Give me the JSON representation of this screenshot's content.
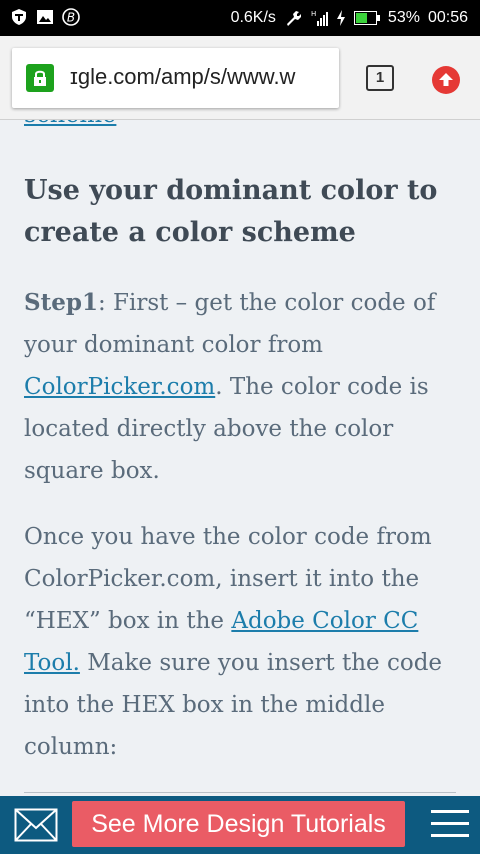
{
  "status_bar": {
    "speed": "0.6K/s",
    "battery": "53%",
    "time": "00:56",
    "icons": [
      "vpn-shield-icon",
      "gallery-icon",
      "bitcoin-icon",
      "wrench-icon",
      "signal-icon",
      "charging-icon",
      "battery-icon"
    ]
  },
  "browser": {
    "url": "ɪgle.com/amp/s/www.w",
    "tab_count": "1",
    "icons": [
      "lock-icon",
      "tabs-icon",
      "update-arrow-icon"
    ],
    "colors": {
      "lock": "#1da21d",
      "update": "#e53935"
    }
  },
  "article": {
    "prev_link": "scheme",
    "heading": "Use your dominant color to create a color scheme",
    "step_label": "Step1",
    "step_text_1": ": First – get the color code of your dominant color from ",
    "step_link": "ColorPicker.com",
    "step_text_2": ". The color code is located directly above the color square box.",
    "para2_text_1": "Once you have the color code from ColorPicker.com, insert it into the “HEX” box in the ",
    "para2_link": "Adobe Color CC Tool.",
    "para2_text_2": " Make sure you insert the code into the HEX box in the middle column:"
  },
  "bottom_bar": {
    "cta_label": "See More Design Tutorials",
    "icons": [
      "mail-icon",
      "menu-icon"
    ],
    "colors": {
      "bar": "#0d5a80",
      "cta": "#ea5c65"
    }
  }
}
